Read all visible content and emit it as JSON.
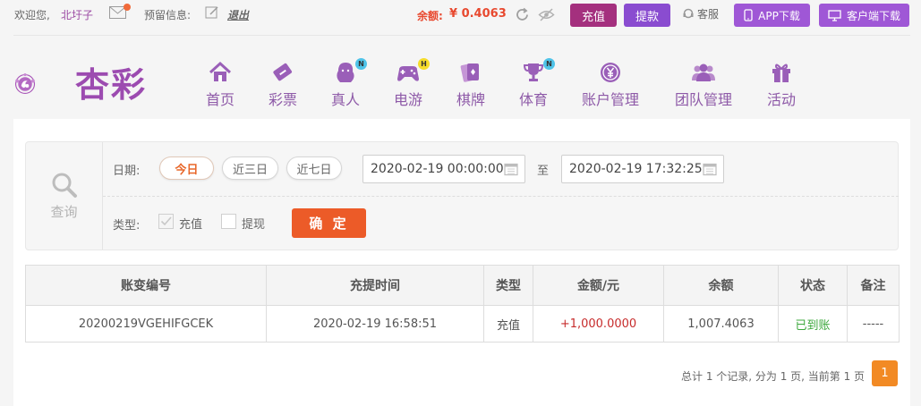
{
  "topbar": {
    "welcome": "欢迎您,",
    "username": "北圩子",
    "notice_label": "预留信息:",
    "logout": "退出",
    "balance_label": "余额:",
    "balance_value": "¥ 0.4063",
    "recharge": "充值",
    "withdraw": "提款",
    "service": "客服",
    "app_download": "APP下载",
    "client_download": "客户端下载"
  },
  "logo": {
    "text": "杏彩"
  },
  "nav": [
    {
      "label": "首页",
      "icon": "home-icon"
    },
    {
      "label": "彩票",
      "icon": "lottery-ticket-icon"
    },
    {
      "label": "真人",
      "icon": "live-dealer-icon",
      "badge": "N"
    },
    {
      "label": "电游",
      "icon": "gamepad-icon",
      "badge": "H"
    },
    {
      "label": "棋牌",
      "icon": "cards-icon"
    },
    {
      "label": "体育",
      "icon": "trophy-icon",
      "badge": "N"
    },
    {
      "label": "账户管理",
      "icon": "yen-coin-icon"
    },
    {
      "label": "团队管理",
      "icon": "team-icon"
    },
    {
      "label": "活动",
      "icon": "gift-icon"
    }
  ],
  "query": {
    "side_label": "查询",
    "date_label": "日期:",
    "ranges": [
      "今日",
      "近三日",
      "近七日"
    ],
    "start": "2020-02-19 00:00:00",
    "to": "至",
    "end": "2020-02-19 17:32:25",
    "type_label": "类型:",
    "types": [
      {
        "label": "充值",
        "checked": true
      },
      {
        "label": "提现",
        "checked": false
      }
    ],
    "confirm": "确 定"
  },
  "table": {
    "headers": [
      "账变编号",
      "充提时间",
      "类型",
      "金额/元",
      "余额",
      "状态",
      "备注"
    ],
    "rows": [
      [
        "20200219VGEHIFGCEK",
        "2020-02-19 16:58:51",
        "充值",
        "+1,000.0000",
        "1,007.4063",
        "已到账",
        "-----"
      ]
    ]
  },
  "pager": {
    "summary": "总计 1 个记录, 分为 1 页, 当前第 1 页",
    "current": "1"
  },
  "colors": {
    "brand_purple": "#9c4bb0",
    "recharge_btn": "#a4307e",
    "withdraw_btn": "#8a4cd0",
    "confirm_btn": "#ec5b28",
    "balance_red": "#e8492f",
    "pager_orange": "#f28a24",
    "status_green": "#3da83d"
  }
}
